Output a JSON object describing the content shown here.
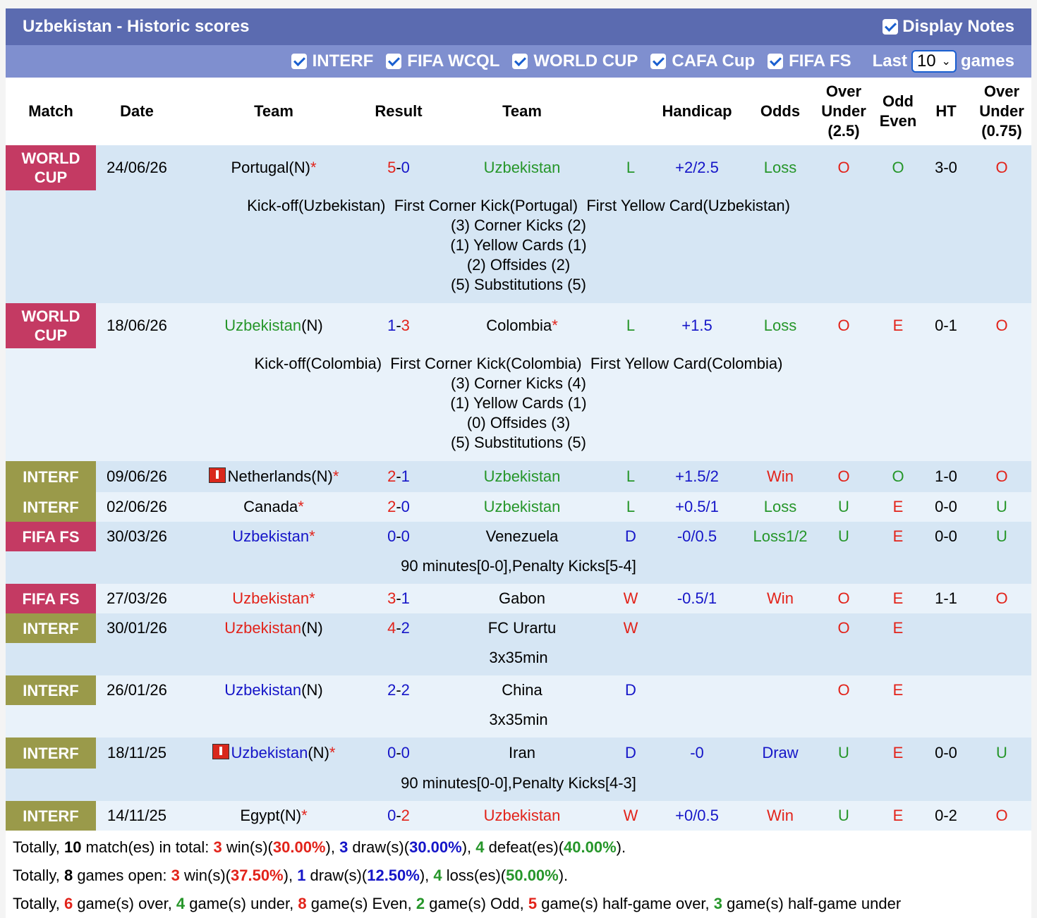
{
  "header": {
    "title": "Uzbekistan - Historic scores",
    "display_notes": "Display Notes"
  },
  "filters": {
    "items": [
      "INTERF",
      "FIFA WCQL",
      "WORLD CUP",
      "CAFA Cup",
      "FIFA FS"
    ],
    "last_label": "Last",
    "last_value": "10",
    "games_label": "games"
  },
  "columns": {
    "match": "Match",
    "date": "Date",
    "team1": "Team",
    "result": "Result",
    "team2": "Team",
    "handicap": "Handicap",
    "odds": "Odds",
    "ou_l1": "Over",
    "ou_l2": "Under",
    "ou_l3": "(2.5)",
    "oe_l1": "Odd",
    "oe_l2": "Even",
    "ht": "HT",
    "ou2_l1": "Over",
    "ou2_l2": "Under",
    "ou2_l3": "(0.75)"
  },
  "matches": [
    {
      "comp_l1": "WORLD",
      "comp_l2": "CUP",
      "date": "24/06/26",
      "home": "Portugal",
      "home_n": "(N)",
      "home_star": "*",
      "res_h": "5",
      "res_a": "0",
      "away": "Uzbekistan",
      "away_star": "",
      "wl": "L",
      "hcp": "+2/2.5",
      "odds": "Loss",
      "ou": "O",
      "oe": "O",
      "ht": "3-0",
      "ou2": "O",
      "notes": [
        "Kick-off(Uzbekistan)  First Corner Kick(Portugal)  First Yellow Card(Uzbekistan)",
        "(3) Corner Kicks (2)",
        "(1) Yellow Cards (1)",
        "(2) Offsides (2)",
        "(5) Substitutions (5)"
      ]
    },
    {
      "comp_l1": "WORLD",
      "comp_l2": "CUP",
      "date": "18/06/26",
      "home": "Uzbekistan",
      "home_n": "(N)",
      "home_star": "",
      "res_h": "1",
      "res_a": "3",
      "away": "Colombia",
      "away_star": "*",
      "wl": "L",
      "hcp": "+1.5",
      "odds": "Loss",
      "ou": "O",
      "oe": "E",
      "ht": "0-1",
      "ou2": "O",
      "notes": [
        "Kick-off(Colombia)  First Corner Kick(Colombia)  First Yellow Card(Colombia)",
        "(3) Corner Kicks (4)",
        "(1) Yellow Cards (1)",
        "(0) Offsides (3)",
        "(5) Substitutions (5)"
      ]
    },
    {
      "comp_l1": "INTERF",
      "date": "09/06/26",
      "home": "Netherlands",
      "home_n": "(N)",
      "home_star": "*",
      "res_h": "2",
      "res_a": "1",
      "away": "Uzbekistan",
      "away_star": "",
      "wl": "L",
      "hcp": "+1.5/2",
      "odds": "Win",
      "ou": "O",
      "oe": "O",
      "ht": "1-0",
      "ou2": "O"
    },
    {
      "comp_l1": "INTERF",
      "date": "02/06/26",
      "home": "Canada",
      "home_n": "",
      "home_star": "*",
      "res_h": "2",
      "res_a": "0",
      "away": "Uzbekistan",
      "away_star": "",
      "wl": "L",
      "hcp": "+0.5/1",
      "odds": "Loss",
      "ou": "U",
      "oe": "E",
      "ht": "0-0",
      "ou2": "U"
    },
    {
      "comp_l1": "FIFA FS",
      "date": "30/03/26",
      "home": "Uzbekistan",
      "home_n": "",
      "home_star": "*",
      "res_h": "0",
      "res_a": "0",
      "away": "Venezuela",
      "away_star": "",
      "wl": "D",
      "hcp": "-0/0.5",
      "odds": "Loss1/2",
      "ou": "U",
      "oe": "E",
      "ht": "0-0",
      "ou2": "U",
      "notes": [
        "90 minutes[0-0],Penalty Kicks[5-4]"
      ]
    },
    {
      "comp_l1": "FIFA FS",
      "date": "27/03/26",
      "home": "Uzbekistan",
      "home_n": "",
      "home_star": "*",
      "res_h": "3",
      "res_a": "1",
      "away": "Gabon",
      "away_star": "",
      "wl": "W",
      "hcp": "-0.5/1",
      "odds": "Win",
      "ou": "O",
      "oe": "E",
      "ht": "1-1",
      "ou2": "O"
    },
    {
      "comp_l1": "INTERF",
      "date": "30/01/26",
      "home": "Uzbekistan",
      "home_n": "(N)",
      "home_star": "",
      "res_h": "4",
      "res_a": "2",
      "away": "FC Urartu",
      "away_star": "",
      "wl": "W",
      "hcp": "",
      "odds": "",
      "ou": "O",
      "oe": "E",
      "ht": "",
      "ou2": "",
      "notes": [
        "3x35min"
      ]
    },
    {
      "comp_l1": "INTERF",
      "date": "26/01/26",
      "home": "Uzbekistan",
      "home_n": "(N)",
      "home_star": "",
      "res_h": "2",
      "res_a": "2",
      "away": "China",
      "away_star": "",
      "wl": "D",
      "hcp": "",
      "odds": "",
      "ou": "O",
      "oe": "E",
      "ht": "",
      "ou2": "",
      "notes": [
        "3x35min"
      ]
    },
    {
      "comp_l1": "INTERF",
      "date": "18/11/25",
      "home": "Uzbekistan",
      "home_n": "(N)",
      "home_star": "*",
      "res_h": "0",
      "res_a": "0",
      "away": "Iran",
      "away_star": "",
      "wl": "D",
      "hcp": "-0",
      "odds": "Draw",
      "ou": "U",
      "oe": "E",
      "ht": "0-0",
      "ou2": "U",
      "notes": [
        "90 minutes[0-0],Penalty Kicks[4-3]"
      ]
    },
    {
      "comp_l1": "INTERF",
      "date": "14/11/25",
      "home": "Egypt",
      "home_n": "(N)",
      "home_star": "*",
      "res_h": "0",
      "res_a": "2",
      "away": "Uzbekistan",
      "away_star": "",
      "wl": "W",
      "hcp": "+0/0.5",
      "odds": "Win",
      "ou": "U",
      "oe": "E",
      "ht": "0-2",
      "ou2": "O"
    }
  ],
  "summary": {
    "l1": {
      "a": "Totally, ",
      "n1": "10",
      "b": " match(es) in total: ",
      "n2": "3",
      "c": " win(s)(",
      "p2": "30.00%",
      "d": "), ",
      "n3": "3",
      "e": " draw(s)(",
      "p3": "30.00%",
      "f": "), ",
      "n4": "4",
      "g": " defeat(es)(",
      "p4": "40.00%",
      "h": ")."
    },
    "l2": {
      "a": "Totally, ",
      "n1": "8",
      "b": " games open: ",
      "n2": "3",
      "c": " win(s)(",
      "p2": "37.50%",
      "d": "), ",
      "n3": "1",
      "e": " draw(s)(",
      "p3": "12.50%",
      "f": "), ",
      "n4": "4",
      "g": " loss(es)(",
      "p4": "50.00%",
      "h": ")."
    },
    "l3": {
      "a": "Totally, ",
      "n1": "6",
      "b": " game(s) over, ",
      "n2": "4",
      "c": " game(s) under, ",
      "n3": "8",
      "d": " game(s) Even, ",
      "n4": "2",
      "e": " game(s) Odd, ",
      "n5": "5",
      "f": " game(s) half-game over, ",
      "n6": "3",
      "g": " game(s) half-game under"
    }
  }
}
